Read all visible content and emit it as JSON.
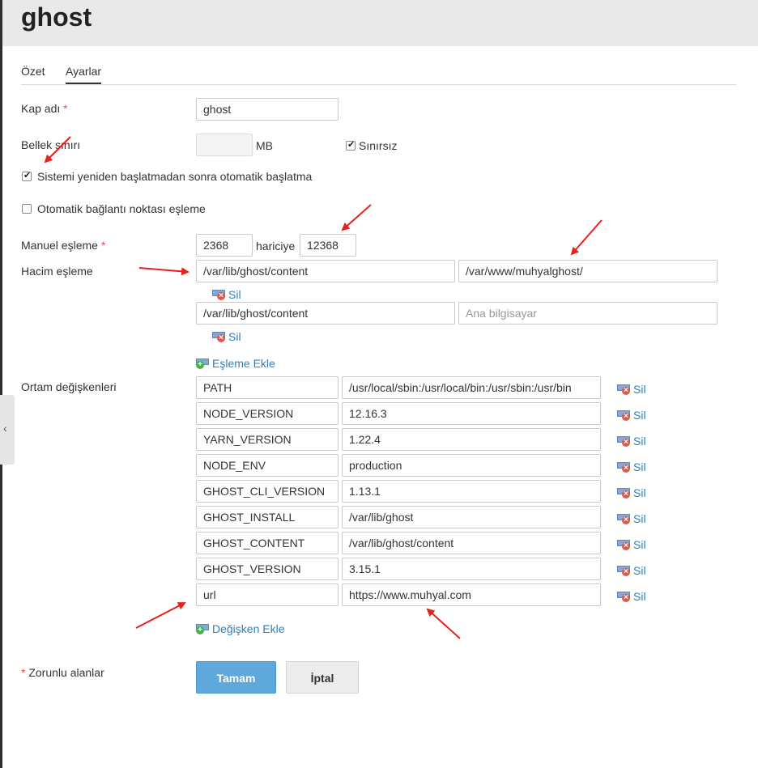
{
  "title": "ghost",
  "tabs": [
    {
      "label": "Özet",
      "active": false
    },
    {
      "label": "Ayarlar",
      "active": true
    }
  ],
  "form": {
    "container_name": {
      "label": "Kap adı",
      "required_mark": "*",
      "value": "ghost"
    },
    "memory_limit": {
      "label": "Bellek sınırı",
      "value": "",
      "unit": "MB",
      "unlimited_label": "Sınırsız",
      "unlimited_checked": true
    },
    "auto_start": {
      "label": "Sistemi yeniden başlatmadan sonra otomatik başlatma",
      "checked": true
    },
    "auto_port_mapping": {
      "label": "Otomatik bağlantı noktası eşleme",
      "checked": false
    },
    "manual_mapping": {
      "label": "Manuel eşleme",
      "required_mark": "*",
      "internal_port": "2368",
      "separator": "hariciye",
      "external_port": "12368"
    },
    "volume_mapping": {
      "label": "Hacim eşleme",
      "rows": [
        {
          "container_path": "/var/lib/ghost/content",
          "host_path": "/var/www/muhyalghost/",
          "host_placeholder": "",
          "delete_label": "Sil"
        },
        {
          "container_path": "/var/lib/ghost/content",
          "host_path": "",
          "host_placeholder": "Ana bilgisayar",
          "delete_label": "Sil"
        }
      ],
      "add_label": "Eşleme Ekle"
    },
    "env_vars": {
      "label": "Ortam değişkenleri",
      "rows": [
        {
          "name": "PATH",
          "value": "/usr/local/sbin:/usr/local/bin:/usr/sbin:/usr/bin",
          "delete_label": "Sil"
        },
        {
          "name": "NODE_VERSION",
          "value": "12.16.3",
          "delete_label": "Sil"
        },
        {
          "name": "YARN_VERSION",
          "value": "1.22.4",
          "delete_label": "Sil"
        },
        {
          "name": "NODE_ENV",
          "value": "production",
          "delete_label": "Sil"
        },
        {
          "name": "GHOST_CLI_VERSION",
          "value": "1.13.1",
          "delete_label": "Sil"
        },
        {
          "name": "GHOST_INSTALL",
          "value": "/var/lib/ghost",
          "delete_label": "Sil"
        },
        {
          "name": "GHOST_CONTENT",
          "value": "/var/lib/ghost/content",
          "delete_label": "Sil"
        },
        {
          "name": "GHOST_VERSION",
          "value": "3.15.1",
          "delete_label": "Sil"
        },
        {
          "name": "url",
          "value": "https://www.muhyal.com",
          "delete_label": "Sil"
        }
      ],
      "add_label": "Değişken Ekle"
    },
    "required_note": {
      "mark": "*",
      "text": "Zorunlu alanlar"
    },
    "buttons": {
      "ok": "Tamam",
      "cancel": "İptal"
    }
  },
  "colors": {
    "accent": "#5fa8dc",
    "link": "#2f7fbf",
    "required": "#d9534f",
    "annotation_arrow": "#e8201a",
    "header_bg": "#e9e9e9"
  },
  "icons": {
    "side_toggle": "chevron-left-icon",
    "delete": "delete-mapping-icon",
    "add": "add-mapping-icon"
  }
}
